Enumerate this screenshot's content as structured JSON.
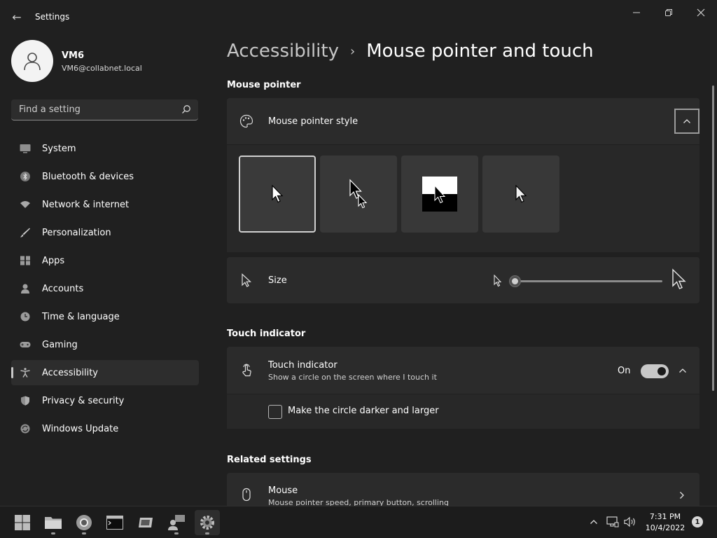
{
  "window": {
    "title": "Settings",
    "back_glyph": "←",
    "controls": [
      "minimize-icon",
      "restore-icon",
      "close-icon"
    ]
  },
  "user": {
    "name": "VM6",
    "email": "VM6@collabnet.local",
    "avatar_icon": "person-icon"
  },
  "search": {
    "placeholder": "Find a setting",
    "value": ""
  },
  "sidebar": {
    "items": [
      {
        "label": "System",
        "icon": "monitor-icon",
        "active": false
      },
      {
        "label": "Bluetooth & devices",
        "icon": "bluetooth-icon",
        "active": false
      },
      {
        "label": "Network & internet",
        "icon": "wifi-icon",
        "active": false
      },
      {
        "label": "Personalization",
        "icon": "brush-icon",
        "active": false
      },
      {
        "label": "Apps",
        "icon": "apps-icon",
        "active": false
      },
      {
        "label": "Accounts",
        "icon": "account-icon",
        "active": false
      },
      {
        "label": "Time & language",
        "icon": "clock-globe-icon",
        "active": false
      },
      {
        "label": "Gaming",
        "icon": "gamepad-icon",
        "active": false
      },
      {
        "label": "Accessibility",
        "icon": "accessibility-icon",
        "active": true
      },
      {
        "label": "Privacy & security",
        "icon": "shield-icon",
        "active": false
      },
      {
        "label": "Windows Update",
        "icon": "update-icon",
        "active": false
      }
    ]
  },
  "breadcrumb": {
    "parent": "Accessibility",
    "separator": "›",
    "current": "Mouse pointer and touch"
  },
  "mouse_pointer": {
    "section_title": "Mouse pointer",
    "style_label": "Mouse pointer style",
    "style_options": [
      {
        "name": "white",
        "selected": true
      },
      {
        "name": "black",
        "selected": false
      },
      {
        "name": "inverted",
        "selected": false
      },
      {
        "name": "custom",
        "selected": false
      }
    ],
    "size_label": "Size",
    "size_value": 1
  },
  "touch": {
    "section_title": "Touch indicator",
    "label": "Touch indicator",
    "description": "Show a circle on the screen where I touch it",
    "state_label": "On",
    "enabled": true,
    "checkbox_label": "Make the circle darker and larger",
    "checkbox_checked": false
  },
  "related": {
    "section_title": "Related settings",
    "mouse_label": "Mouse",
    "mouse_desc": "Mouse pointer speed, primary button, scrolling"
  },
  "taskbar": {
    "apps": [
      "start-icon",
      "file-explorer-icon",
      "chrome-icon",
      "terminal-icon",
      "app-icon",
      "remote-users-icon",
      "settings-gear-icon"
    ],
    "time": "7:31 PM",
    "date": "10/4/2022",
    "notification_count": "1"
  }
}
